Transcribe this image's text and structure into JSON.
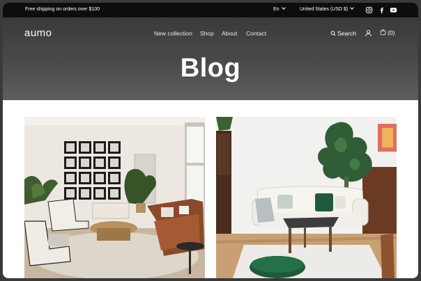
{
  "announcement": "Free shipping on orders over $100",
  "language": "En",
  "currency": "United States (USD $)",
  "social": [
    "instagram-icon",
    "facebook-icon",
    "youtube-icon"
  ],
  "brand": "aumo",
  "nav": [
    "New collection",
    "Shop",
    "About",
    "Contact"
  ],
  "search_label": "Search",
  "cart_count": "(0)",
  "page_title": "Blog",
  "colors": {
    "topbar": "#0d0d0d",
    "hero_top": "#3a3a3a",
    "hero_bottom": "#5e5e5e",
    "accent_green": "#1d5a3c"
  }
}
